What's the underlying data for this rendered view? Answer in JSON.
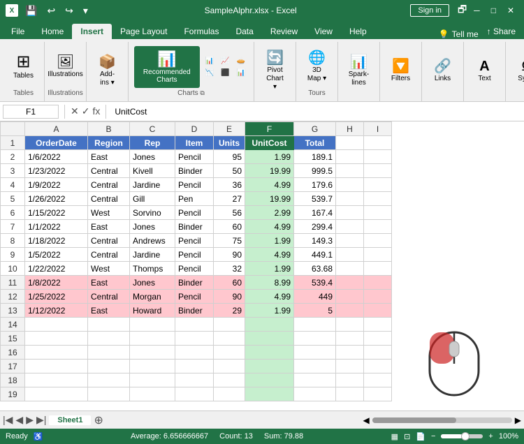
{
  "titlebar": {
    "filename": "SampleAlphr.xlsx - Excel",
    "signin": "Sign in",
    "quickaccess": [
      "save",
      "undo",
      "redo"
    ]
  },
  "ribbon": {
    "tabs": [
      "File",
      "Home",
      "Insert",
      "Page Layout",
      "Formulas",
      "Data",
      "Review",
      "View",
      "Help",
      "Tell me"
    ],
    "active_tab": "Insert",
    "groups": [
      {
        "label": "Tables",
        "buttons": [
          {
            "icon": "⊞",
            "label": "Tables"
          }
        ]
      },
      {
        "label": "Illustrations",
        "buttons": [
          {
            "icon": "🖼",
            "label": "Illustrations"
          }
        ]
      },
      {
        "label": "",
        "buttons": [
          {
            "icon": "📊",
            "label": "Add-ins"
          }
        ]
      },
      {
        "label": "Charts",
        "buttons": [
          {
            "icon": "📊",
            "label": "Recommended\nCharts",
            "highlighted": true
          },
          {
            "icon": "📈",
            "label": ""
          },
          {
            "icon": "📊",
            "label": ""
          },
          {
            "icon": "📉",
            "label": ""
          }
        ]
      },
      {
        "label": "",
        "buttons": [
          {
            "icon": "🔄",
            "label": "PivotChart"
          }
        ]
      },
      {
        "label": "Tours",
        "buttons": [
          {
            "icon": "🌐",
            "label": "3D Map"
          }
        ]
      },
      {
        "label": "",
        "buttons": [
          {
            "icon": "📊",
            "label": "Sparklines"
          }
        ]
      },
      {
        "label": "",
        "buttons": [
          {
            "icon": "🔽",
            "label": "Filters"
          }
        ]
      },
      {
        "label": "",
        "buttons": [
          {
            "icon": "🔗",
            "label": "Links"
          }
        ]
      },
      {
        "label": "",
        "buttons": [
          {
            "icon": "T",
            "label": "Text"
          }
        ]
      },
      {
        "label": "",
        "buttons": [
          {
            "icon": "Ω",
            "label": "Symb"
          }
        ]
      }
    ]
  },
  "formula_bar": {
    "name_box": "F1",
    "formula": "UnitCost"
  },
  "columns": [
    "",
    "A",
    "B",
    "C",
    "D",
    "E",
    "F",
    "G",
    "H",
    "I"
  ],
  "headers": [
    "OrderDate",
    "Region",
    "Rep",
    "Item",
    "Units",
    "UnitCost",
    "Total"
  ],
  "rows": [
    {
      "num": 2,
      "a": "1/6/2022",
      "b": "East",
      "c": "Jones",
      "d": "Pencil",
      "e": "95",
      "f": "1.99",
      "g": "189.1",
      "pink": false
    },
    {
      "num": 3,
      "a": "1/23/2022",
      "b": "Central",
      "c": "Kivell",
      "d": "Binder",
      "e": "50",
      "f": "19.99",
      "g": "999.5",
      "pink": false
    },
    {
      "num": 4,
      "a": "1/9/2022",
      "b": "Central",
      "c": "Jardine",
      "d": "Pencil",
      "e": "36",
      "f": "4.99",
      "g": "179.6",
      "pink": false
    },
    {
      "num": 5,
      "a": "1/26/2022",
      "b": "Central",
      "c": "Gill",
      "d": "Pen",
      "e": "27",
      "f": "19.99",
      "g": "539.7",
      "pink": false
    },
    {
      "num": 6,
      "a": "1/15/2022",
      "b": "West",
      "c": "Sorvino",
      "d": "Pencil",
      "e": "56",
      "f": "2.99",
      "g": "167.4",
      "pink": false
    },
    {
      "num": 7,
      "a": "1/1/2022",
      "b": "East",
      "c": "Jones",
      "d": "Binder",
      "e": "60",
      "f": "4.99",
      "g": "299.4",
      "pink": false
    },
    {
      "num": 8,
      "a": "1/18/2022",
      "b": "Central",
      "c": "Andrews",
      "d": "Pencil",
      "e": "75",
      "f": "1.99",
      "g": "149.3",
      "pink": false
    },
    {
      "num": 9,
      "a": "1/5/2022",
      "b": "Central",
      "c": "Jardine",
      "d": "Pencil",
      "e": "90",
      "f": "4.99",
      "g": "449.1",
      "pink": false
    },
    {
      "num": 10,
      "a": "1/22/2022",
      "b": "West",
      "c": "Thomps",
      "d": "Pencil",
      "e": "32",
      "f": "1.99",
      "g": "63.68",
      "pink": false
    },
    {
      "num": 11,
      "a": "1/8/2022",
      "b": "East",
      "c": "Jones",
      "d": "Binder",
      "e": "60",
      "f": "8.99",
      "g": "539.4",
      "pink": true
    },
    {
      "num": 12,
      "a": "1/25/2022",
      "b": "Central",
      "c": "Morgan",
      "d": "Pencil",
      "e": "90",
      "f": "4.99",
      "g": "449",
      "pink": true
    },
    {
      "num": 13,
      "a": "1/12/2022",
      "b": "East",
      "c": "Howard",
      "d": "Binder",
      "e": "29",
      "f": "1.99",
      "g": "5",
      "pink": true
    }
  ],
  "empty_rows": [
    14,
    15,
    16,
    17,
    18,
    19
  ],
  "status_bar": {
    "average": "Average: 6.656666667",
    "count": "Count: 13",
    "sum": "Sum: 79.88"
  },
  "sheet_tab": "Sheet1",
  "selected_col": "F"
}
